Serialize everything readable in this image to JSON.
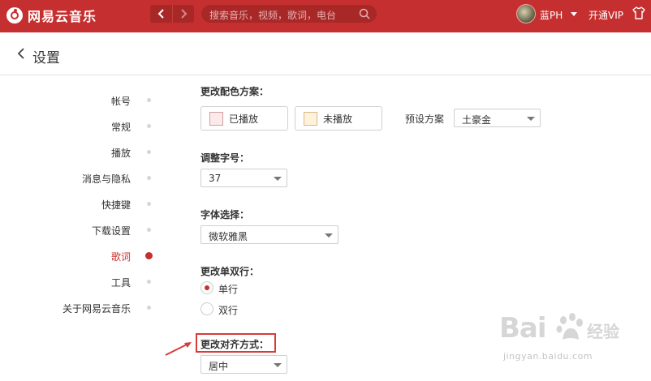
{
  "app": {
    "title": "网易云音乐"
  },
  "topbar": {
    "search_placeholder": "搜索音乐，视频，歌词，电台",
    "username": "蓝PH",
    "vip_label": "开通VIP"
  },
  "header": {
    "title": "设置"
  },
  "menu": {
    "items": [
      {
        "label": "帐号",
        "active": false
      },
      {
        "label": "常规",
        "active": false
      },
      {
        "label": "播放",
        "active": false
      },
      {
        "label": "消息与隐私",
        "active": false
      },
      {
        "label": "快捷键",
        "active": false
      },
      {
        "label": "下载设置",
        "active": false
      },
      {
        "label": "歌词",
        "active": true
      },
      {
        "label": "工具",
        "active": false
      },
      {
        "label": "关于网易云音乐",
        "active": false
      }
    ]
  },
  "lyrics": {
    "color_scheme": {
      "title": "更改配色方案：",
      "played_label": "已播放",
      "played_color": "#fde8ea",
      "unplayed_label": "未播放",
      "unplayed_color": "#fff2dc",
      "preset_label": "预设方案",
      "preset_value": "土豪金"
    },
    "font_size": {
      "title": "调整字号：",
      "value": "37"
    },
    "font_family": {
      "title": "字体选择：",
      "value": "微软雅黑"
    },
    "line_mode": {
      "title": "更改单双行：",
      "options": [
        {
          "label": "单行",
          "checked": true
        },
        {
          "label": "双行",
          "checked": false
        }
      ]
    },
    "alignment": {
      "title": "更改对齐方式：",
      "value": "居中"
    }
  },
  "watermark": {
    "brand": "Bai",
    "brand_suffix": "经验",
    "url": "jingyan.baidu.com"
  },
  "colors": {
    "accent": "#c62f2f",
    "annotation": "#d93a3a"
  }
}
